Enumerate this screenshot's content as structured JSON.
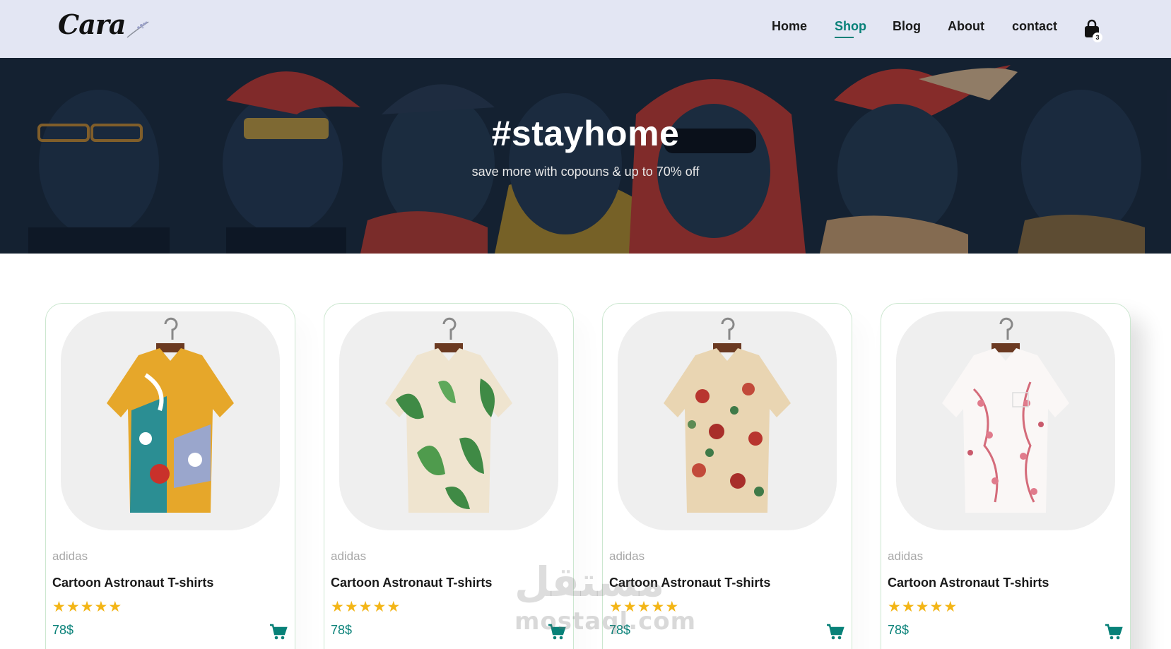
{
  "header": {
    "logo_text": "Cara",
    "nav": [
      {
        "label": "Home",
        "active": false
      },
      {
        "label": "Shop",
        "active": true
      },
      {
        "label": "Blog",
        "active": false
      },
      {
        "label": "About",
        "active": false
      },
      {
        "label": "contact",
        "active": false
      }
    ],
    "cart_count": "3",
    "cart_icon": "shopping-bag-icon"
  },
  "hero": {
    "title": "#stayhome",
    "subtitle": "save more with copouns & up to 70% off"
  },
  "products": [
    {
      "brand": "adidas",
      "name": "Cartoon Astronaut T-shirts",
      "rating": 5,
      "price": "78$",
      "image": "shirt-floral-teal-orange"
    },
    {
      "brand": "adidas",
      "name": "Cartoon Astronaut T-shirts",
      "rating": 5,
      "price": "78$",
      "image": "shirt-leaf-green-cream"
    },
    {
      "brand": "adidas",
      "name": "Cartoon Astronaut T-shirts",
      "rating": 5,
      "price": "78$",
      "image": "shirt-rose-beige"
    },
    {
      "brand": "adidas",
      "name": "Cartoon Astronaut T-shirts",
      "rating": 5,
      "price": "78$",
      "image": "shirt-blossom-white"
    }
  ],
  "watermark": {
    "latin": "mostaql.com",
    "arabic": "مستقل"
  },
  "colors": {
    "accent": "#088178",
    "header_bg": "#e3e6f3",
    "star": "#f3b516"
  }
}
